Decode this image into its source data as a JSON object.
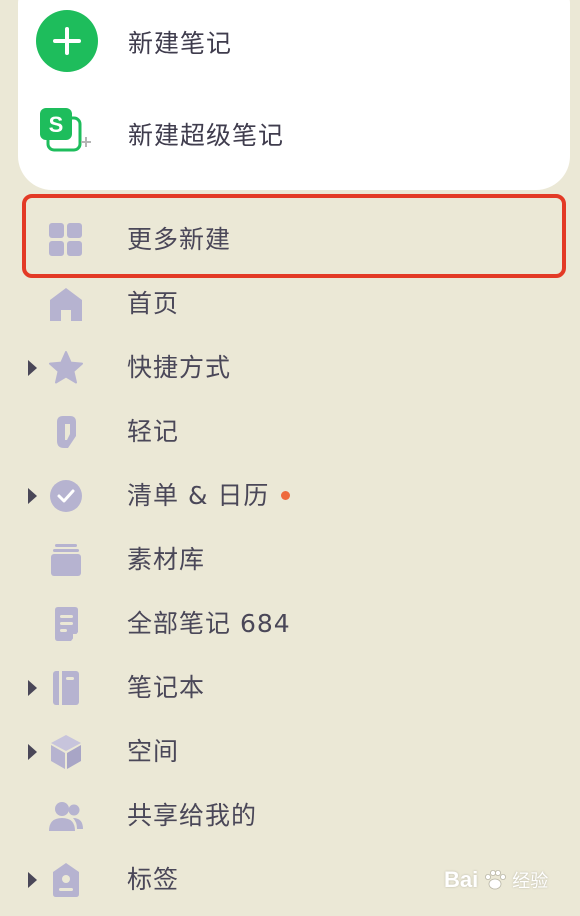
{
  "new_section": {
    "new_note_label": "新建笔记",
    "new_super_note_label": "新建超级笔记"
  },
  "nav": {
    "items": [
      {
        "label": "更多新建",
        "icon": "grid-icon",
        "expandable": false
      },
      {
        "label": "首页",
        "icon": "home-icon",
        "expandable": false
      },
      {
        "label": "快捷方式",
        "icon": "star-icon",
        "expandable": true
      },
      {
        "label": "轻记",
        "icon": "quick-note-icon",
        "expandable": false
      },
      {
        "label": "清单 & 日历",
        "icon": "check-circle-icon",
        "expandable": true,
        "has_dot": true
      },
      {
        "label": "素材库",
        "icon": "library-icon",
        "expandable": false
      },
      {
        "label": "全部笔记 684",
        "icon": "document-icon",
        "expandable": false
      },
      {
        "label": "笔记本",
        "icon": "notebook-icon",
        "expandable": true
      },
      {
        "label": "空间",
        "icon": "cube-icon",
        "expandable": true
      },
      {
        "label": "共享给我的",
        "icon": "shared-users-icon",
        "expandable": false
      },
      {
        "label": "标签",
        "icon": "tag-icon",
        "expandable": true
      }
    ]
  },
  "watermark": {
    "brand": "Bai",
    "suffix": "经验"
  },
  "colors": {
    "background": "#ebe8d6",
    "icon": "#b6b3d0",
    "accent_green": "#1ebd5c",
    "highlight_red": "#e33a26",
    "dot_orange": "#ee6a3c"
  }
}
